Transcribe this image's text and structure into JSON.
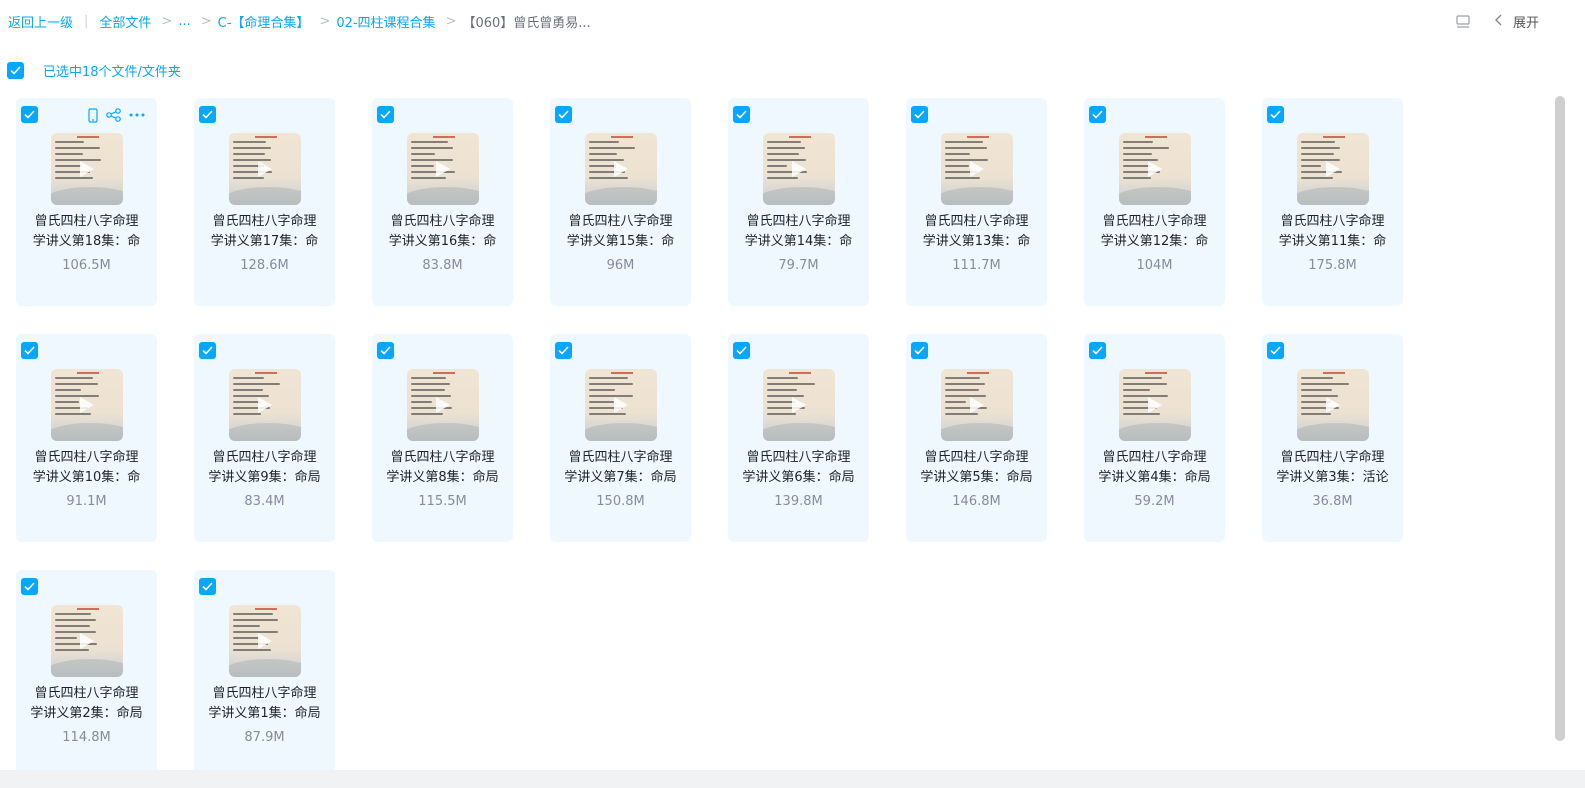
{
  "breadcrumb": {
    "back": "返回上一级",
    "all_files": "全部文件",
    "ellipsis": "...",
    "path1": "C-【命理合集】",
    "path2": "02-四柱课程合集",
    "current": "【060】曾氏曾勇易..."
  },
  "toolbar": {
    "expand_label": "展开"
  },
  "selection": {
    "text": "已选中18个文件/文件夹"
  },
  "files": [
    {
      "line1": "曾氏四柱八字命理",
      "line2": "学讲义第18集：命",
      "size": "106.5M"
    },
    {
      "line1": "曾氏四柱八字命理",
      "line2": "学讲义第17集：命",
      "size": "128.6M"
    },
    {
      "line1": "曾氏四柱八字命理",
      "line2": "学讲义第16集：命",
      "size": "83.8M"
    },
    {
      "line1": "曾氏四柱八字命理",
      "line2": "学讲义第15集：命",
      "size": "96M"
    },
    {
      "line1": "曾氏四柱八字命理",
      "line2": "学讲义第14集：命",
      "size": "79.7M"
    },
    {
      "line1": "曾氏四柱八字命理",
      "line2": "学讲义第13集：命",
      "size": "111.7M"
    },
    {
      "line1": "曾氏四柱八字命理",
      "line2": "学讲义第12集：命",
      "size": "104M"
    },
    {
      "line1": "曾氏四柱八字命理",
      "line2": "学讲义第11集：命",
      "size": "175.8M"
    },
    {
      "line1": "曾氏四柱八字命理",
      "line2": "学讲义第10集：命",
      "size": "91.1M"
    },
    {
      "line1": "曾氏四柱八字命理",
      "line2": "学讲义第9集：命局",
      "size": "83.4M"
    },
    {
      "line1": "曾氏四柱八字命理",
      "line2": "学讲义第8集：命局",
      "size": "115.5M"
    },
    {
      "line1": "曾氏四柱八字命理",
      "line2": "学讲义第7集：命局",
      "size": "150.8M"
    },
    {
      "line1": "曾氏四柱八字命理",
      "line2": "学讲义第6集：命局",
      "size": "139.8M"
    },
    {
      "line1": "曾氏四柱八字命理",
      "line2": "学讲义第5集：命局",
      "size": "146.8M"
    },
    {
      "line1": "曾氏四柱八字命理",
      "line2": "学讲义第4集：命局",
      "size": "59.2M"
    },
    {
      "line1": "曾氏四柱八字命理",
      "line2": "学讲义第3集：活论",
      "size": "36.8M"
    },
    {
      "line1": "曾氏四柱八字命理",
      "line2": "学讲义第2集：命局",
      "size": "114.8M"
    },
    {
      "line1": "曾氏四柱八字命理",
      "line2": "学讲义第1集：命局",
      "size": "87.9M"
    }
  ],
  "colors": {
    "accent": "#06a7ff",
    "card_bg": "#eef8fe",
    "size_text": "#878c9c"
  },
  "icons": {
    "layout": "list-layout-icon",
    "expand": "chevron-left-icon",
    "check": "check-icon",
    "phone": "phone-icon",
    "share": "share-icon",
    "more": "more-icon",
    "play": "play-icon"
  }
}
